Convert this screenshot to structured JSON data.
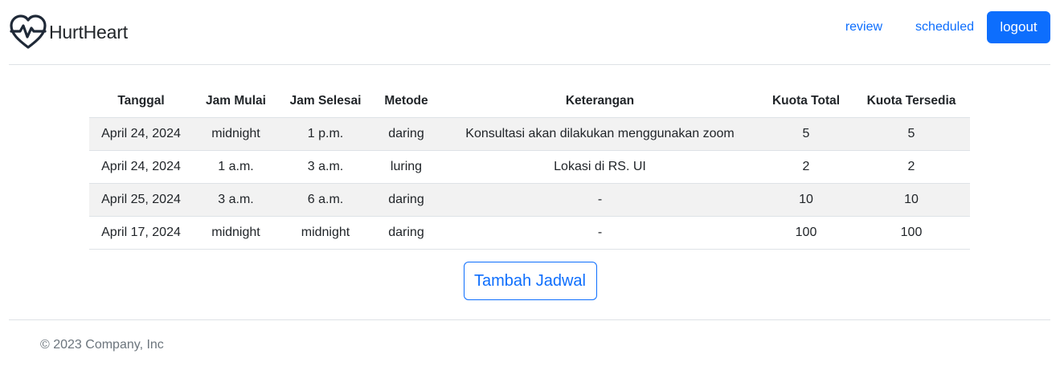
{
  "brand": {
    "name": "HurtHeart",
    "logo_icon": "heart-pulse-icon",
    "logo_color": "#1f2937"
  },
  "nav": {
    "review": "review",
    "scheduled": "scheduled",
    "logout": "logout"
  },
  "colors": {
    "primary": "#0d6efd",
    "stripe": "#f2f2f2",
    "muted": "#6c757d"
  },
  "table": {
    "headers": [
      "Tanggal",
      "Jam Mulai",
      "Jam Selesai",
      "Metode",
      "Keterangan",
      "Kuota Total",
      "Kuota Tersedia"
    ],
    "rows": [
      [
        "April 24, 2024",
        "midnight",
        "1 p.m.",
        "daring",
        "Konsultasi akan dilakukan menggunakan zoom",
        "5",
        "5"
      ],
      [
        "April 24, 2024",
        "1 a.m.",
        "3 a.m.",
        "luring",
        "Lokasi di RS. UI",
        "2",
        "2"
      ],
      [
        "April 25, 2024",
        "3 a.m.",
        "6 a.m.",
        "daring",
        "-",
        "10",
        "10"
      ],
      [
        "April 17, 2024",
        "midnight",
        "midnight",
        "daring",
        "-",
        "100",
        "100"
      ]
    ]
  },
  "actions": {
    "add_schedule": "Tambah Jadwal"
  },
  "footer": {
    "copyright": "© 2023 Company, Inc"
  }
}
